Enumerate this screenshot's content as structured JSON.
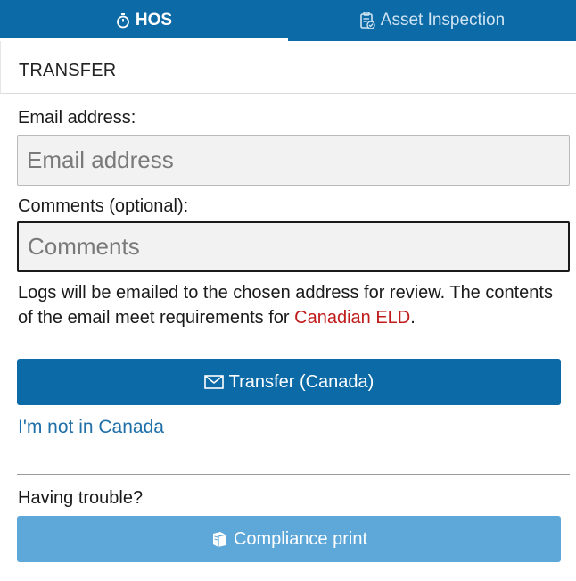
{
  "tabs": [
    {
      "label": "HOS",
      "icon": "stopwatch-icon",
      "active": true
    },
    {
      "label": "Asset Inspection",
      "icon": "clipboard-check-icon",
      "active": false
    }
  ],
  "page": {
    "title": "TRANSFER"
  },
  "form": {
    "email_label": "Email address:",
    "email_placeholder": "Email address",
    "email_value": "",
    "comments_label": "Comments (optional):",
    "comments_placeholder": "Comments",
    "comments_value": ""
  },
  "info": {
    "text_before": "Logs will be emailed to the chosen address for review. The contents of the email meet requirements for ",
    "highlight": "Canadian ELD",
    "text_after": "."
  },
  "actions": {
    "transfer_label": "Transfer (Canada)",
    "transfer_icon": "envelope-icon",
    "not_canada_link": "I'm not in Canada",
    "trouble_label": "Having trouble?",
    "compliance_label": "Compliance print",
    "compliance_icon": "book-icon"
  },
  "colors": {
    "primary": "#0c6aa6",
    "secondary_button": "#5ea7d9",
    "link": "#1f6fa8",
    "highlight": "#c01c1c"
  }
}
